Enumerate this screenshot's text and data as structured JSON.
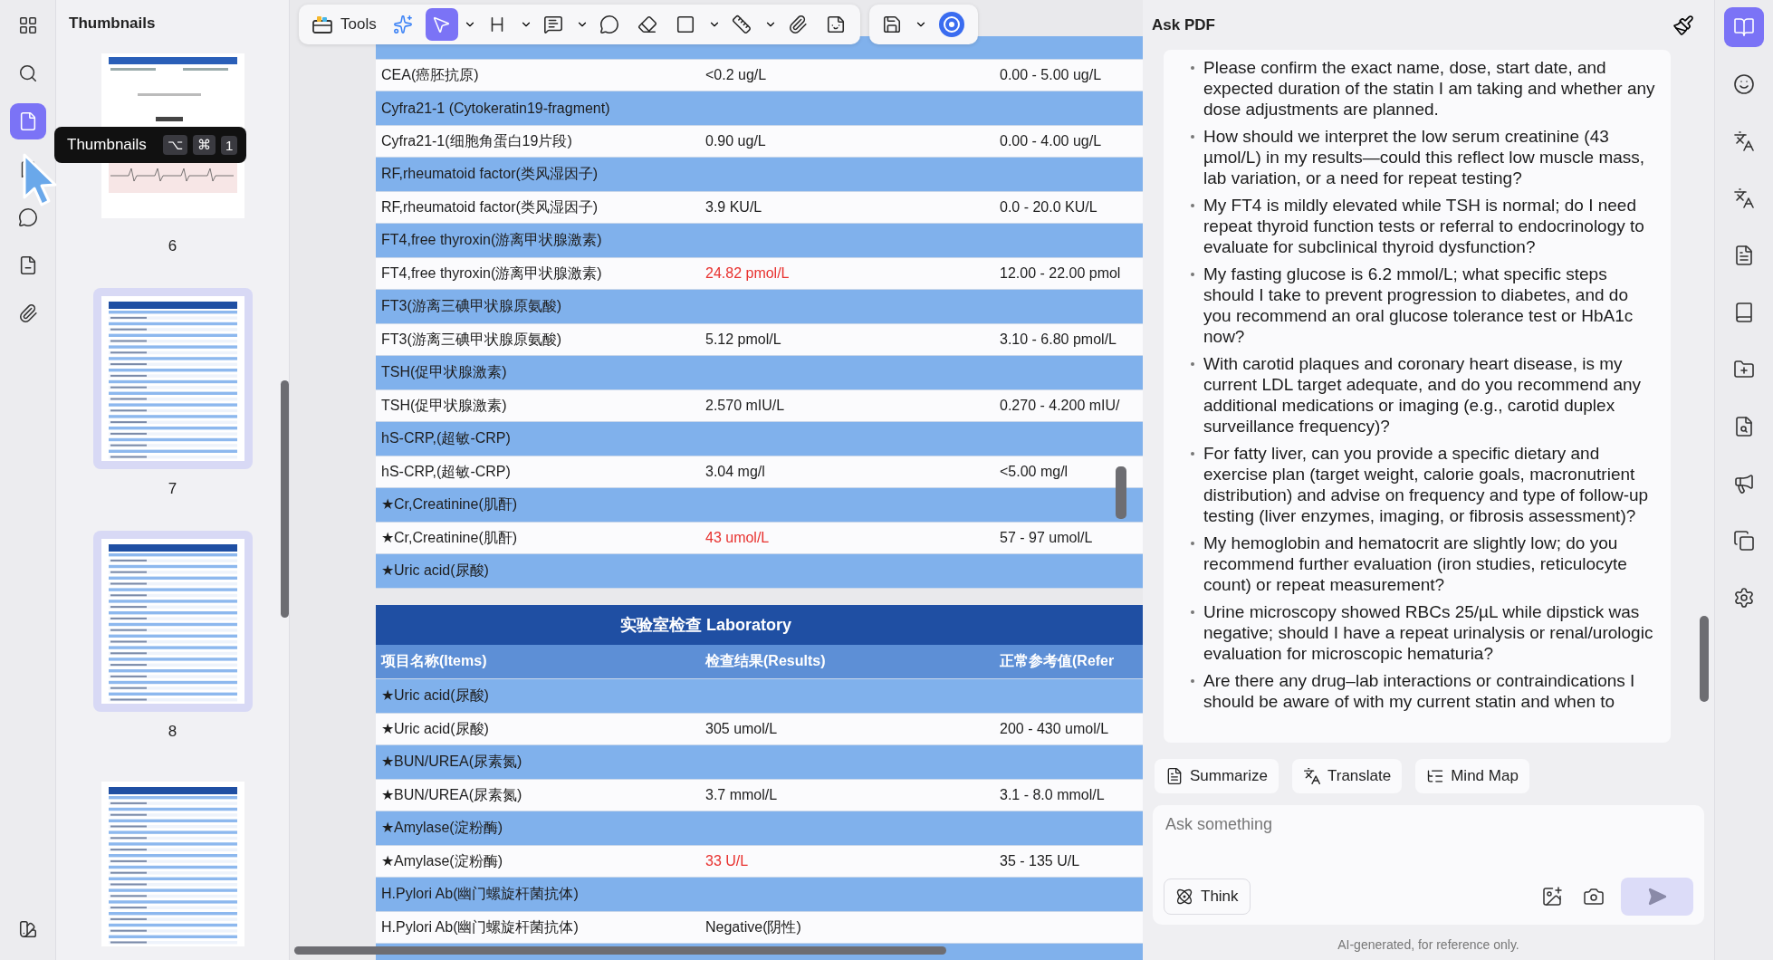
{
  "left_rail": {
    "items": [
      {
        "kind": "grid",
        "selected": false
      },
      {
        "kind": "search",
        "selected": false
      },
      {
        "kind": "thumbnails",
        "selected": true
      },
      {
        "kind": "bookmark",
        "selected": false
      },
      {
        "kind": "comments",
        "selected": false
      },
      {
        "kind": "form",
        "selected": false
      },
      {
        "kind": "attachment",
        "selected": false
      }
    ],
    "bottom": {
      "kind": "swatch"
    }
  },
  "thumbnails_panel": {
    "title": "Thumbnails",
    "pages": [
      {
        "kind": "ecg",
        "label": "6",
        "selected": false
      },
      {
        "kind": "table",
        "label": "7",
        "selected": true
      },
      {
        "kind": "table",
        "label": "8",
        "selected": true
      },
      {
        "kind": "table",
        "selected": false
      }
    ]
  },
  "tooltip": {
    "text": "Thumbnails",
    "keys": [
      "⌥",
      "⌘",
      "1"
    ]
  },
  "toolbar": {
    "groups": [
      [
        {
          "kind": "tools",
          "label": "Tools",
          "selected": false,
          "menu": false
        },
        {
          "kind": "ai",
          "selected": false,
          "menu": false
        },
        {
          "kind": "select",
          "selected": true,
          "menu": true
        },
        {
          "kind": "heading",
          "selected": false,
          "menu": true
        },
        {
          "kind": "note",
          "selected": false,
          "menu": true
        },
        {
          "kind": "comment",
          "selected": false,
          "menu": false
        },
        {
          "kind": "eraser",
          "selected": false,
          "menu": false
        },
        {
          "kind": "shape",
          "selected": false,
          "menu": true
        },
        {
          "kind": "measure",
          "selected": false,
          "menu": true
        },
        {
          "kind": "attach",
          "selected": false,
          "menu": false
        },
        {
          "kind": "sticker",
          "selected": false,
          "menu": false
        }
      ],
      [
        {
          "kind": "save",
          "selected": false,
          "menu": true
        },
        {
          "kind": "orb",
          "selected": false,
          "menu": false
        }
      ]
    ]
  },
  "document": {
    "pages": [
      {
        "rows": [
          {
            "kind": "group"
          },
          {
            "kind": "result",
            "name": "CEA(癌胚抗原)",
            "result": "<0.2 ug/L",
            "reference": "0.00 - 5.00 ug/L",
            "abnormal": false
          },
          {
            "kind": "group",
            "name": "Cyfra21-1 (Cytokeratin19-fragment)"
          },
          {
            "kind": "result",
            "name": "Cyfra21-1(细胞角蛋白19片段)",
            "result": "0.90 ug/L",
            "reference": "0.00 - 4.00 ug/L",
            "abnormal": false
          },
          {
            "kind": "group",
            "name": "RF,rheumatoid factor(类风湿因子)"
          },
          {
            "kind": "result",
            "name": "RF,rheumatoid factor(类风湿因子)",
            "result": "3.9 KU/L",
            "reference": "0.0 - 20.0 KU/L",
            "abnormal": false
          },
          {
            "kind": "group",
            "name": "FT4,free thyroxin(游离甲状腺激素)"
          },
          {
            "kind": "result",
            "name": "FT4,free thyroxin(游离甲状腺激素)",
            "result": "24.82 pmol/L",
            "reference": "12.00 - 22.00 pmol",
            "abnormal": true
          },
          {
            "kind": "group",
            "name": "FT3(游离三碘甲状腺原氨酸)"
          },
          {
            "kind": "result",
            "name": "FT3(游离三碘甲状腺原氨酸)",
            "result": "5.12 pmol/L",
            "reference": "3.10 - 6.80 pmol/L",
            "abnormal": false
          },
          {
            "kind": "group",
            "name": "TSH(促甲状腺激素)"
          },
          {
            "kind": "result",
            "name": "TSH(促甲状腺激素)",
            "result": "2.570 mIU/L",
            "reference": "0.270 - 4.200 mIU/",
            "abnormal": false
          },
          {
            "kind": "group",
            "name": "hS-CRP,(超敏-CRP)"
          },
          {
            "kind": "result",
            "name": "hS-CRP,(超敏-CRP)",
            "result": "3.04 mg/l",
            "reference": "<5.00 mg/l",
            "abnormal": false
          },
          {
            "kind": "group",
            "name": "★Cr,Creatinine(肌酐)"
          },
          {
            "kind": "result",
            "name": "★Cr,Creatinine(肌酐)",
            "result": "43 umol/L",
            "reference": "57 - 97 umol/L",
            "abnormal": true
          },
          {
            "kind": "group",
            "name": "★Uric acid(尿酸)"
          }
        ]
      },
      {
        "title": "实验室检查 Laboratory",
        "columns": [
          "项目名称(Items)",
          "检查结果(Results)",
          "正常参考值(Refer"
        ],
        "rows": [
          {
            "kind": "group",
            "name": "★Uric acid(尿酸)"
          },
          {
            "kind": "result",
            "name": "★Uric acid(尿酸)",
            "result": "305 umol/L",
            "reference": "200 - 430 umol/L",
            "abnormal": false
          },
          {
            "kind": "group",
            "name": "★BUN/UREA(尿素氮)"
          },
          {
            "kind": "result",
            "name": "★BUN/UREA(尿素氮)",
            "result": "3.7 mmol/L",
            "reference": "3.1 - 8.0 mmol/L",
            "abnormal": false
          },
          {
            "kind": "group",
            "name": "★Amylase(淀粉酶)"
          },
          {
            "kind": "result",
            "name": "★Amylase(淀粉酶)",
            "result": "33 U/L",
            "reference": "35 - 135 U/L",
            "abnormal": true
          },
          {
            "kind": "group",
            "name": "H.Pylori Ab(幽门螺旋杆菌抗体)"
          },
          {
            "kind": "result",
            "name": "H.Pylori Ab(幽门螺旋杆菌抗体)",
            "result": "Negative(阴性)",
            "abnormal": false
          },
          {
            "kind": "group"
          }
        ]
      }
    ]
  },
  "ask_pdf": {
    "title": "Ask PDF",
    "answer": [
      "Please confirm the exact name, dose, start date, and expected duration of the statin I am taking and whether any dose adjustments are planned.",
      "How should we interpret the low serum creatinine (43 µmol/L) in my results—could this reflect low muscle mass, lab variation, or a need for repeat testing?",
      "My FT4 is mildly elevated while TSH is normal; do I need repeat thyroid function tests or referral to endocrinology to evaluate for subclinical thyroid dysfunction?",
      "My fasting glucose is 6.2 mmol/L; what specific steps should I take to prevent progression to diabetes, and do you recommend an oral glucose tolerance test or HbA1c now?",
      "With carotid plaques and coronary heart disease, is my current LDL target adequate, and do you recommend any additional medications or imaging (e.g., carotid duplex surveillance frequency)?",
      "For fatty liver, can you provide a specific dietary and exercise plan (target weight, calorie goals, macronutrient distribution) and advise on frequency and type of follow-up testing (liver enzymes, imaging, or fibrosis assessment)?",
      "My hemoglobin and hematocrit are slightly low; do you recommend further evaluation (iron studies, reticulocyte count) or repeat measurement?",
      "Urine microscopy showed RBCs 25/µL while dipstick was negative; should I have a repeat urinalysis or renal/urologic evaluation for microscopic hematuria?",
      "Are there any drug–lab interactions or contraindications I should be aware of with my current statin and when to"
    ],
    "actions": [
      {
        "kind": "summarize",
        "label": "Summarize"
      },
      {
        "kind": "translate",
        "label": "Translate"
      },
      {
        "kind": "mindmap",
        "label": "Mind Map"
      }
    ],
    "input": {
      "placeholder": "Ask something"
    },
    "think": {
      "label": "Think"
    },
    "send": {
      "disabled": true
    },
    "disclaimer": "AI-generated, for reference only."
  },
  "right_rail": {
    "items": [
      {
        "kind": "ask",
        "selected": true
      },
      {
        "kind": "chat",
        "selected": false
      },
      {
        "kind": "translate",
        "selected": false
      },
      {
        "kind": "translate-page",
        "selected": false
      },
      {
        "kind": "summary",
        "selected": false
      },
      {
        "kind": "book",
        "selected": false
      },
      {
        "kind": "folder",
        "selected": false
      },
      {
        "kind": "find",
        "selected": false
      },
      {
        "kind": "present",
        "selected": false
      },
      {
        "kind": "copy",
        "selected": false
      },
      {
        "kind": "settings",
        "selected": false
      }
    ]
  }
}
